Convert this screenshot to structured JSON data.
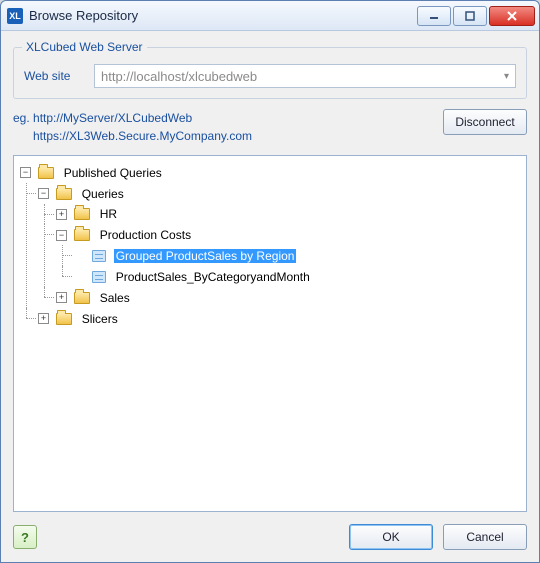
{
  "window": {
    "title": "Browse Repository",
    "app_icon_text": "XL"
  },
  "group": {
    "title": "XLCubed Web Server",
    "website_label": "Web site",
    "website_value": "http://localhost/xlcubedweb"
  },
  "examples": {
    "prefix": "eg.",
    "line1": "http://MyServer/XLCubedWeb",
    "line2": "https://XL3Web.Secure.MyCompany.com"
  },
  "buttons": {
    "disconnect": "Disconnect",
    "ok": "OK",
    "cancel": "Cancel",
    "help_symbol": "?"
  },
  "tree": {
    "root": "Published Queries",
    "queries": "Queries",
    "hr": "HR",
    "production_costs": "Production Costs",
    "item_grouped": "Grouped ProductSales by Region",
    "item_bycat": "ProductSales_ByCategoryandMonth",
    "sales": "Sales",
    "slicers": "Slicers"
  }
}
